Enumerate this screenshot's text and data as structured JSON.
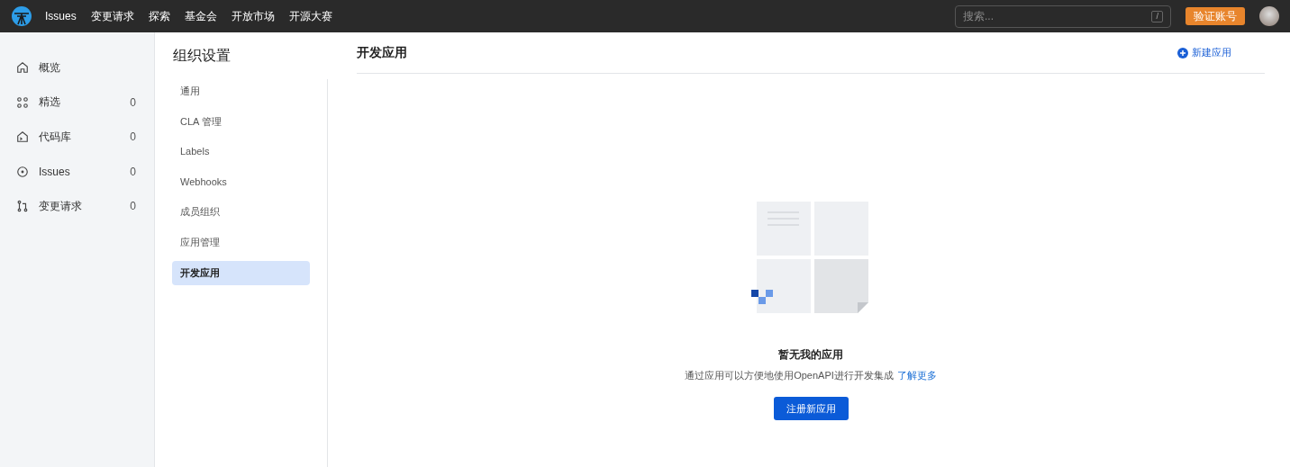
{
  "topnav": {
    "items": [
      "Issues",
      "变更请求",
      "探索",
      "基金会",
      "开放市场",
      "开源大赛"
    ],
    "search": {
      "placeholder": "搜索...",
      "shortcut": "/"
    },
    "verify_button": "验证账号"
  },
  "sidebar": {
    "items": [
      {
        "kind": "home",
        "label": "概览"
      },
      {
        "kind": "grid",
        "label": "精选",
        "count": "0"
      },
      {
        "kind": "repo",
        "label": "代码库",
        "count": "0"
      },
      {
        "kind": "issue",
        "label": "Issues",
        "count": "0"
      },
      {
        "kind": "pr",
        "label": "变更请求",
        "count": "0"
      }
    ]
  },
  "settings": {
    "title": "组织设置",
    "items": [
      {
        "label": "通用",
        "selected": false
      },
      {
        "label": "CLA 管理",
        "selected": false
      },
      {
        "label": "Labels",
        "selected": false
      },
      {
        "label": "Webhooks",
        "selected": false
      },
      {
        "label": "成员组织",
        "selected": false
      },
      {
        "label": "应用管理",
        "selected": false
      },
      {
        "label": "开发应用",
        "selected": true
      }
    ]
  },
  "main": {
    "title": "开发应用",
    "new_button": "新建应用",
    "empty": {
      "title": "暂无我的应用",
      "text": "通过应用可以方便地使用OpenAPI进行开发集成",
      "link": "了解更多",
      "button": "注册新应用"
    }
  }
}
